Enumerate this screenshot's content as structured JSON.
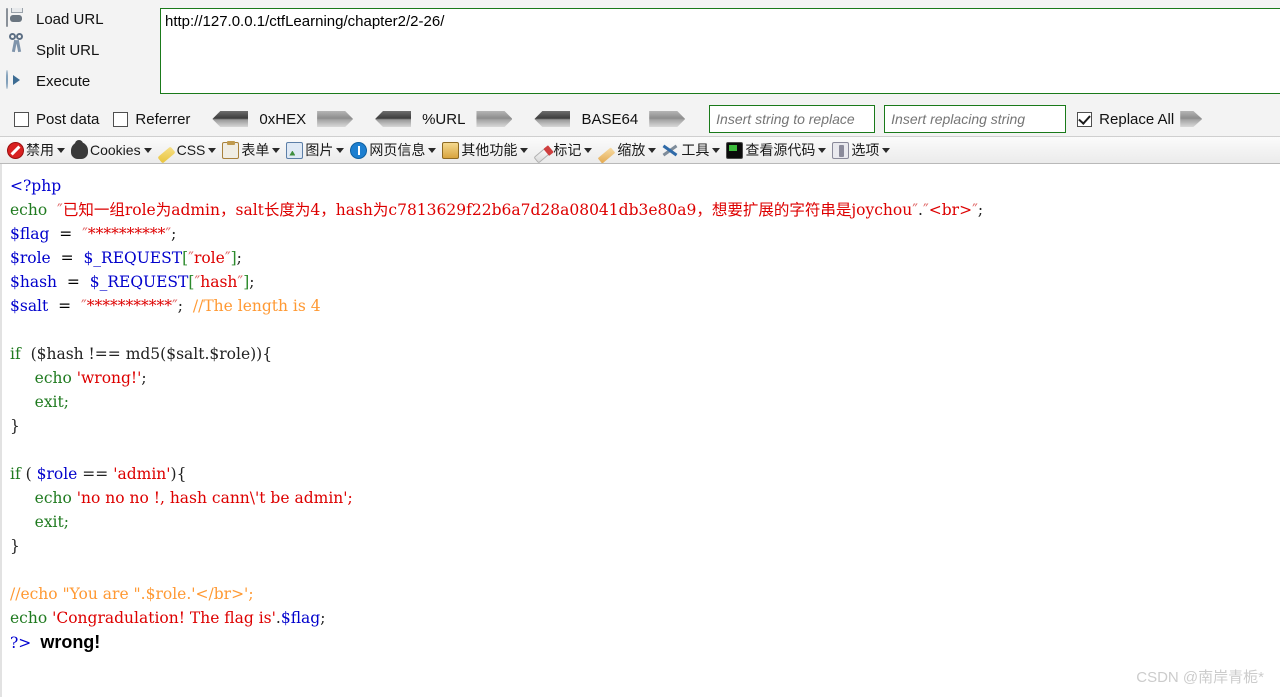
{
  "hackbar": {
    "actions": [
      {
        "label": "Load URL",
        "icon": "disk-icon",
        "name": "load-url"
      },
      {
        "label": "Split URL",
        "icon": "scissors-icon",
        "name": "split-url"
      },
      {
        "label": "Execute",
        "icon": "play-icon",
        "name": "execute"
      }
    ],
    "url_value": "http://127.0.0.1/ctfLearning/chapter2/2-26/",
    "url_placeholder": "",
    "checkboxes": [
      {
        "label": "Post data",
        "checked": false
      },
      {
        "label": "Referrer",
        "checked": false
      }
    ],
    "encoders": [
      "0xHEX",
      "%URL",
      "BASE64"
    ],
    "replace_find_placeholder": "Insert string to replace",
    "replace_find_value": "",
    "replace_with_placeholder": "Insert replacing string",
    "replace_with_value": "",
    "replace_all_label": "Replace All",
    "replace_all_checked": true,
    "border_color": "#1a7a1a"
  },
  "webdev_bar": {
    "items": [
      {
        "label": "禁用",
        "icon": "disable-icon",
        "name": "disable"
      },
      {
        "label": "Cookies",
        "icon": "cookie-icon",
        "name": "cookies"
      },
      {
        "label": "CSS",
        "icon": "css-pencil-icon",
        "name": "css"
      },
      {
        "label": "表单",
        "icon": "form-clipboard-icon",
        "name": "forms"
      },
      {
        "label": "图片",
        "icon": "image-icon",
        "name": "images"
      },
      {
        "label": "网页信息",
        "icon": "info-icon",
        "name": "page-info"
      },
      {
        "label": "其他功能",
        "icon": "misc-icon",
        "name": "misc"
      },
      {
        "label": "标记",
        "icon": "marker-pencil-icon",
        "name": "outline"
      },
      {
        "label": "缩放",
        "icon": "zoom-ruler-icon",
        "name": "resize"
      },
      {
        "label": "工具",
        "icon": "tools-icon",
        "name": "tools"
      },
      {
        "label": "查看源代码",
        "icon": "view-source-icon",
        "name": "view-source"
      },
      {
        "label": "选项",
        "icon": "options-icon",
        "name": "options"
      }
    ]
  },
  "code": {
    "line_open_tag": "<?php",
    "line_echo_kw": "echo",
    "notice_text": "已知一组role为admin，salt长度为4，hash为c7813629f22b6a7d28a08041db3e80a9，想要扩展的字符串是joychou",
    "notice_concat": ".",
    "notice_br": "<br>",
    "flag_var": "$flag",
    "flag_value": "**********",
    "role_var": "$role",
    "role_source": "$_REQUEST",
    "role_key": "role",
    "hash_var": "$hash",
    "hash_source": "$_REQUEST",
    "hash_key": "hash",
    "salt_var": "$salt",
    "salt_value": "***********",
    "salt_comment": "//The length is 4",
    "if1_kw": "if",
    "if1_cond": "($hash !== md5($salt.$role)){",
    "if1_echo": "echo",
    "if1_str": "'wrong!'",
    "if1_exit": "exit;",
    "close_brace": "}",
    "if2_kw": "if",
    "if2_cond_open": "( ",
    "if2_var": "$role",
    "if2_op": " == ",
    "if2_val": "'admin'",
    "if2_cond_close": "){",
    "if2_echo": "echo",
    "if2_str": "'no no no !, hash cann\\'t be admin';",
    "if2_exit": "exit;",
    "comment_line": "//echo \"You are \".$role.'</br>';",
    "final_echo_kw": "echo",
    "final_echo_str": "'Congradulation! The flag is'",
    "final_echo_concat": ".",
    "final_echo_var": "$flag",
    "final_echo_semi": ";",
    "close_tag": "?>"
  },
  "output": {
    "text": "wrong!"
  },
  "watermark": {
    "text": "CSDN @南岸青栀*"
  }
}
